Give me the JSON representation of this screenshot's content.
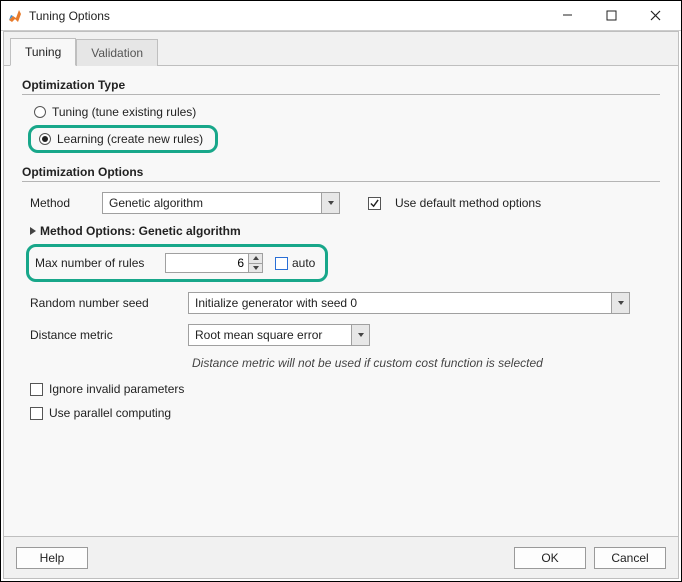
{
  "window": {
    "title": "Tuning Options"
  },
  "tabs": {
    "tuning": "Tuning",
    "validation": "Validation"
  },
  "opt_type": {
    "heading": "Optimization Type",
    "radio_tuning": "Tuning (tune existing rules)",
    "radio_learning": "Learning (create new rules)"
  },
  "opt_options": {
    "heading": "Optimization Options",
    "method_label": "Method",
    "method_value": "Genetic algorithm",
    "use_default_label": "Use default method options",
    "use_default_checked": true,
    "method_options_heading": "Method Options: Genetic algorithm",
    "max_rules_label": "Max number of rules",
    "max_rules_value": "6",
    "auto_label": "auto",
    "seed_label": "Random number seed",
    "seed_value": "Initialize generator with seed 0",
    "distance_label": "Distance metric",
    "distance_value": "Root mean square error",
    "distance_note": "Distance metric will not be used if custom cost function is selected",
    "ignore_invalid_label": "Ignore invalid parameters",
    "parallel_label": "Use parallel computing"
  },
  "footer": {
    "help": "Help",
    "ok": "OK",
    "cancel": "Cancel"
  }
}
